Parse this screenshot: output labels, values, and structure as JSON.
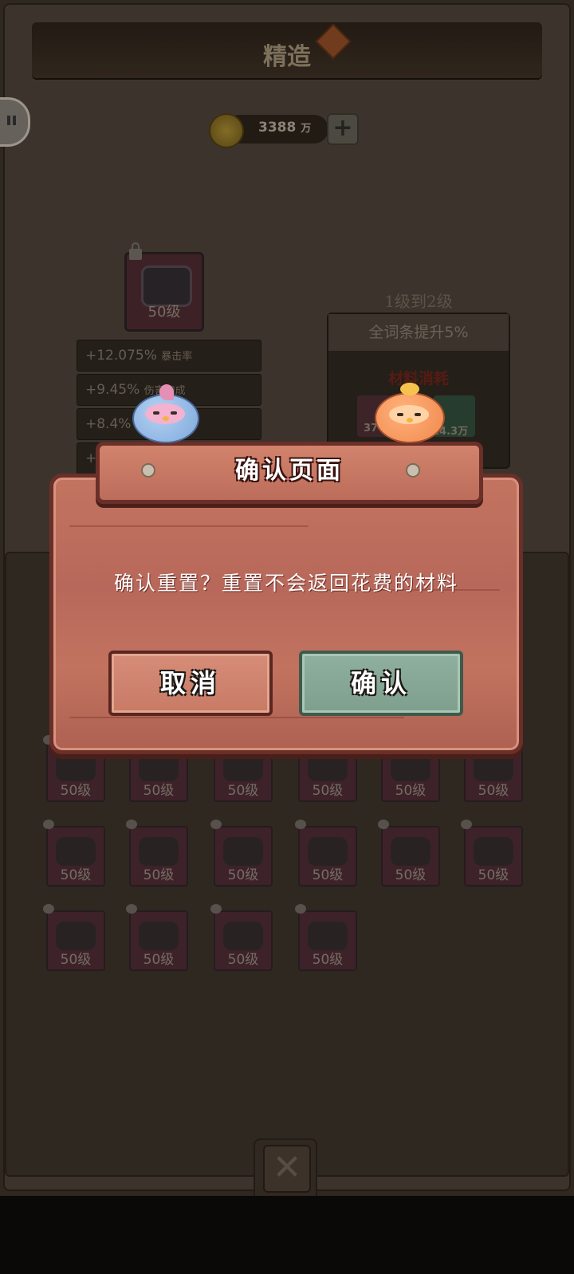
{
  "header": {
    "title": "精造"
  },
  "currency": {
    "amount": "3388",
    "unit": "万",
    "add_label": "+"
  },
  "item": {
    "level": "50级"
  },
  "stats": [
    {
      "value": "+12.075%",
      "label": "暴击率"
    },
    {
      "value": "+9.45%",
      "label": "伤害加成"
    },
    {
      "value": "+8.4%",
      "label": ""
    },
    {
      "value": "+",
      "label": ""
    }
  ],
  "upgrade": {
    "title": "1级到2级",
    "bonus": "全词条提升5%",
    "materials_title": "材料消耗",
    "materials": [
      {
        "amount": "37"
      },
      {
        "amount": "14.3万"
      }
    ]
  },
  "grid": {
    "slots": [
      {
        "level": "50级"
      },
      {
        "level": "50级"
      },
      {
        "level": "50级"
      },
      {
        "level": "50级"
      },
      {
        "level": "50级"
      },
      {
        "level": "50级"
      },
      {
        "level": "50级"
      },
      {
        "level": "50级"
      },
      {
        "level": "50级"
      },
      {
        "level": "50级"
      },
      {
        "level": "50级"
      },
      {
        "level": "50级"
      },
      {
        "level": "50级"
      },
      {
        "level": "50级"
      },
      {
        "level": "50级"
      },
      {
        "level": "50级"
      }
    ]
  },
  "close_label": "✕",
  "dialog": {
    "title": "确认页面",
    "message": "确认重置？重置不会返回花费的材料",
    "cancel_label": "取消",
    "confirm_label": "确认"
  }
}
